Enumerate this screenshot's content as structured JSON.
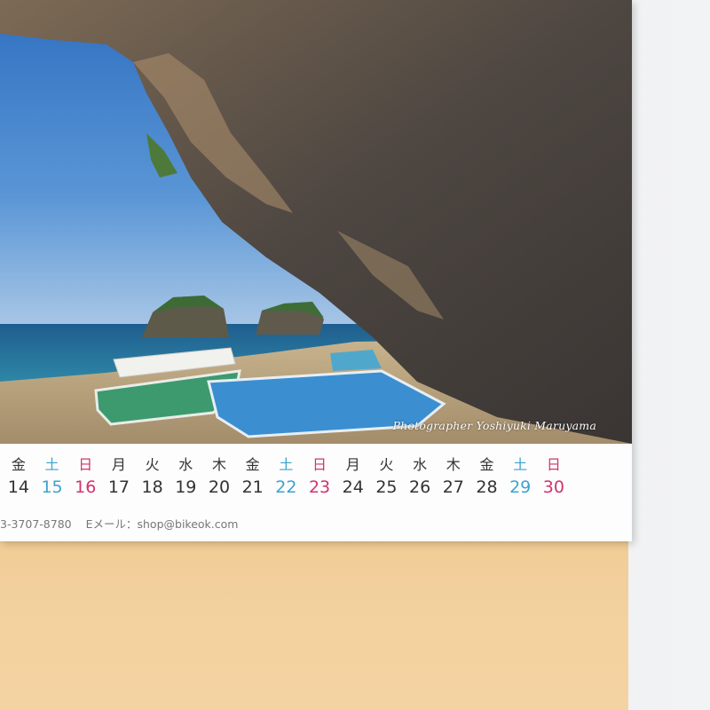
{
  "photo": {
    "description_icons": [
      "sea-cliff",
      "boats"
    ],
    "credit": "Photographer Yoshiyuki Maruyama"
  },
  "calendar": {
    "dows": [
      "金",
      "土",
      "日",
      "月",
      "火",
      "水",
      "木",
      "金",
      "土",
      "日",
      "月",
      "火",
      "水",
      "木",
      "金",
      "土",
      "日"
    ],
    "days": [
      "14",
      "15",
      "16",
      "17",
      "18",
      "19",
      "20",
      "21",
      "22",
      "23",
      "24",
      "25",
      "26",
      "27",
      "28",
      "29",
      "30"
    ],
    "dow_types": [
      "wk",
      "sat",
      "sun",
      "wk",
      "wk",
      "wk",
      "wk",
      "wk",
      "sat",
      "sun",
      "wk",
      "wk",
      "wk",
      "wk",
      "wk",
      "sat",
      "sun"
    ],
    "colors": {
      "weekday": "#333333",
      "saturday": "#3aa3cf",
      "sunday": "#d2336f"
    }
  },
  "contact": {
    "phone_fragment": "3-3707-8780",
    "email_label": "Eメール：shop@bikeok.com"
  }
}
